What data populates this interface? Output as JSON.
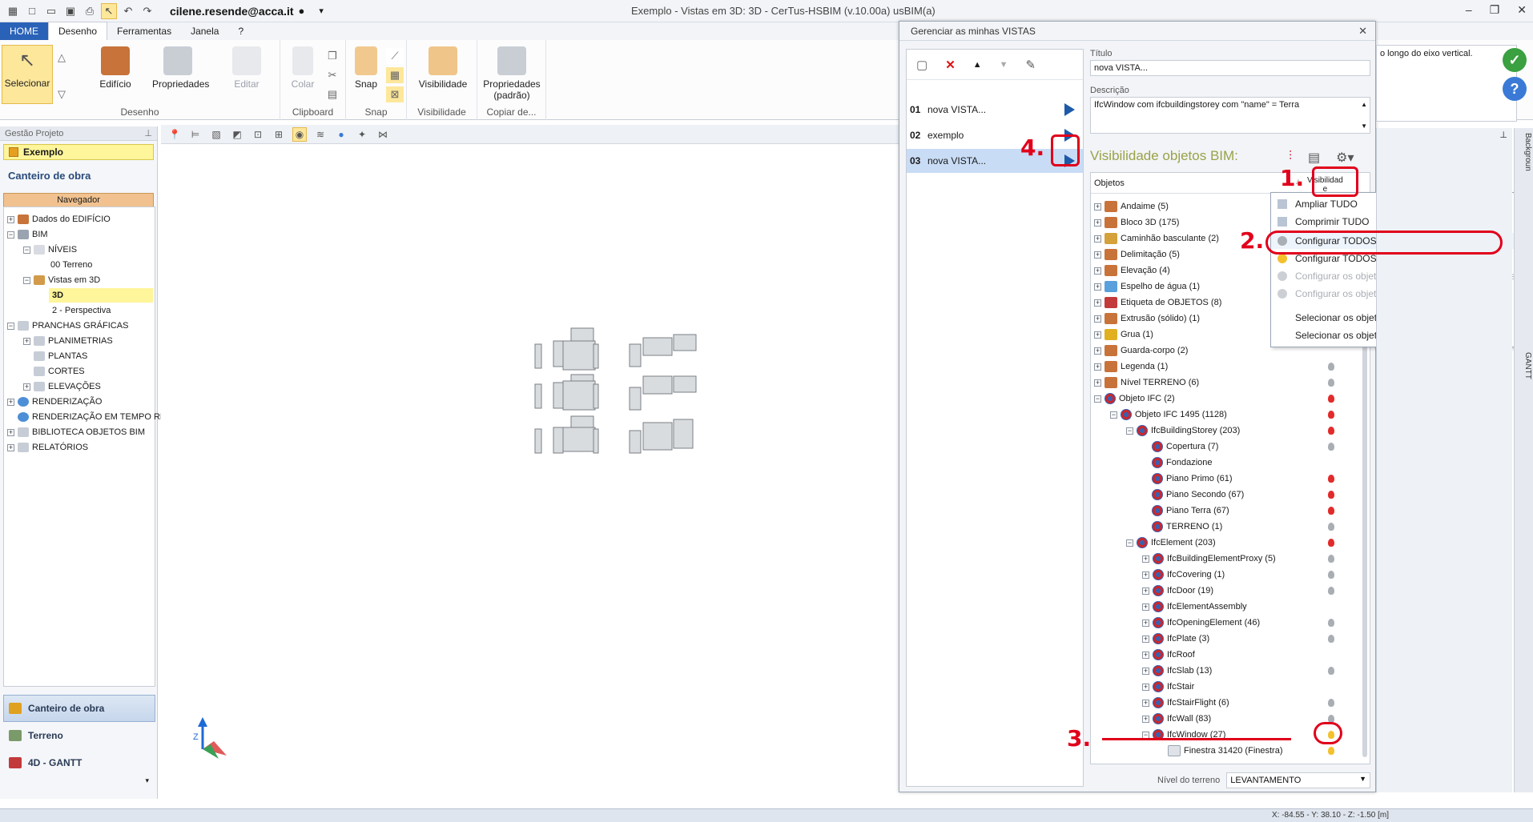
{
  "title_bar": {
    "user": "cilene.resende@acca.it",
    "window_title": "Exemplo - Vistas em 3D: 3D - CerTus-HSBIM (v.10.00a) usBIM(a)"
  },
  "tabs": [
    "HOME",
    "Desenho",
    "Ferramentas",
    "Janela",
    "?"
  ],
  "ribbon": {
    "select": "Selecionar",
    "building": "Edifício",
    "properties": "Propriedades",
    "edit": "Editar",
    "paste": "Colar",
    "snap": "Snap",
    "visibility": "Visibilidade",
    "default_props_1": "Propriedades",
    "default_props_2": "(padrão)",
    "groups": {
      "desenho": "Desenho",
      "clipboard": "Clipboard",
      "snap": "Snap",
      "visibilidade": "Visibilidade",
      "copiar": "Copiar de..."
    }
  },
  "left_panel": {
    "header": "Gestão Projeto",
    "project": "Exemplo",
    "section_title": "Canteiro de obra",
    "navigator": "Navegador",
    "tree": [
      "Dados do EDIFÍCIO",
      "BIM",
      "NÍVEIS",
      "00 Terreno",
      "Vistas em 3D",
      "3D",
      "2 - Perspectiva",
      "PRANCHAS GRÁFICAS",
      "PLANIMETRIAS",
      "PLANTAS",
      "CORTES",
      "ELEVAÇÕES",
      "RENDERIZAÇÃO",
      "RENDERIZAÇÃO EM TEMPO RE...",
      "BIBLIOTECA OBJETOS BIM",
      "RELATÓRIOS"
    ],
    "bottom": [
      "Canteiro de obra",
      "Terreno",
      "4D - GANTT"
    ]
  },
  "dialog": {
    "title": "Gerenciar as minhas VISTAS",
    "views": [
      {
        "num": "01",
        "name": "nova VISTA..."
      },
      {
        "num": "02",
        "name": "exemplo"
      },
      {
        "num": "03",
        "name": "nova VISTA..."
      }
    ],
    "title_label": "Título",
    "title_value": "nova VISTA...",
    "desc_label": "Descrição",
    "desc_value": "IfcWindow com ifcbuildingstorey com \"name\" = Terra",
    "bim_heading": "Visibilidade objetos BIM:",
    "col_objects": "Objetos",
    "col_visibility": "Visibilidad",
    "col_visibility_2": "e",
    "objects": [
      "Andaime (5)",
      "Bloco 3D (175)",
      "Caminhão basculante (2)",
      "Delimitação (5)",
      "Elevação (4)",
      "Espelho de água (1)",
      "Etiqueta de OBJETOS (8)",
      "Extrusão (sólido) (1)",
      "Grua (1)",
      "Guarda-corpo (2)",
      "Legenda (1)",
      "Nível TERRENO (6)",
      "Objeto IFC (2)",
      "Objeto IFC 1495 (1128)",
      "IfcBuildingStorey (203)",
      "Copertura (7)",
      "Fondazione",
      "Piano Primo (61)",
      "Piano Secondo (67)",
      "Piano Terra (67)",
      "TERRENO (1)",
      "IfcElement (203)",
      "IfcBuildingElementProxy (5)",
      "IfcCovering (1)",
      "IfcDoor (19)",
      "IfcElementAssembly",
      "IfcOpeningElement (46)",
      "IfcPlate (3)",
      "IfcRoof",
      "IfcSlab (13)",
      "IfcStair",
      "IfcStairFlight (6)",
      "IfcWall (83)",
      "IfcWindow (27)",
      "Finestra 31420 (Finestra)"
    ],
    "terrain_label": "Nível do terreno",
    "terrain_value": "LEVANTAMENTO"
  },
  "context_menu": [
    "Ampliar TUDO",
    "Comprimir TUDO",
    "Configurar TODOS os objetos como ocultados",
    "Configurar TODOS os objetos como visíveis",
    "Configurar os objetos selecionados como ocultados",
    "Configurar os objetos selecionados como visíveis",
    "Selecionar os objetos visíveis na prancha",
    "Selecionar os objetos ocultados na prancha"
  ],
  "right": {
    "note": "o longo do eixo vertical.",
    "tab_bg": "Backgroun",
    "tab_gantt": "GANTT"
  },
  "status": {
    "coords": "X: -84.55 - Y: 38.10 - Z: -1.50 [m]"
  },
  "annotations": [
    "1.",
    "2.",
    "3.",
    "4."
  ],
  "axis_label": "Z",
  "colors": {
    "home_tab": "#2a62b8",
    "highlight": "#fff59a",
    "annotation": "#e1001b",
    "play": "#1d5aa8"
  }
}
